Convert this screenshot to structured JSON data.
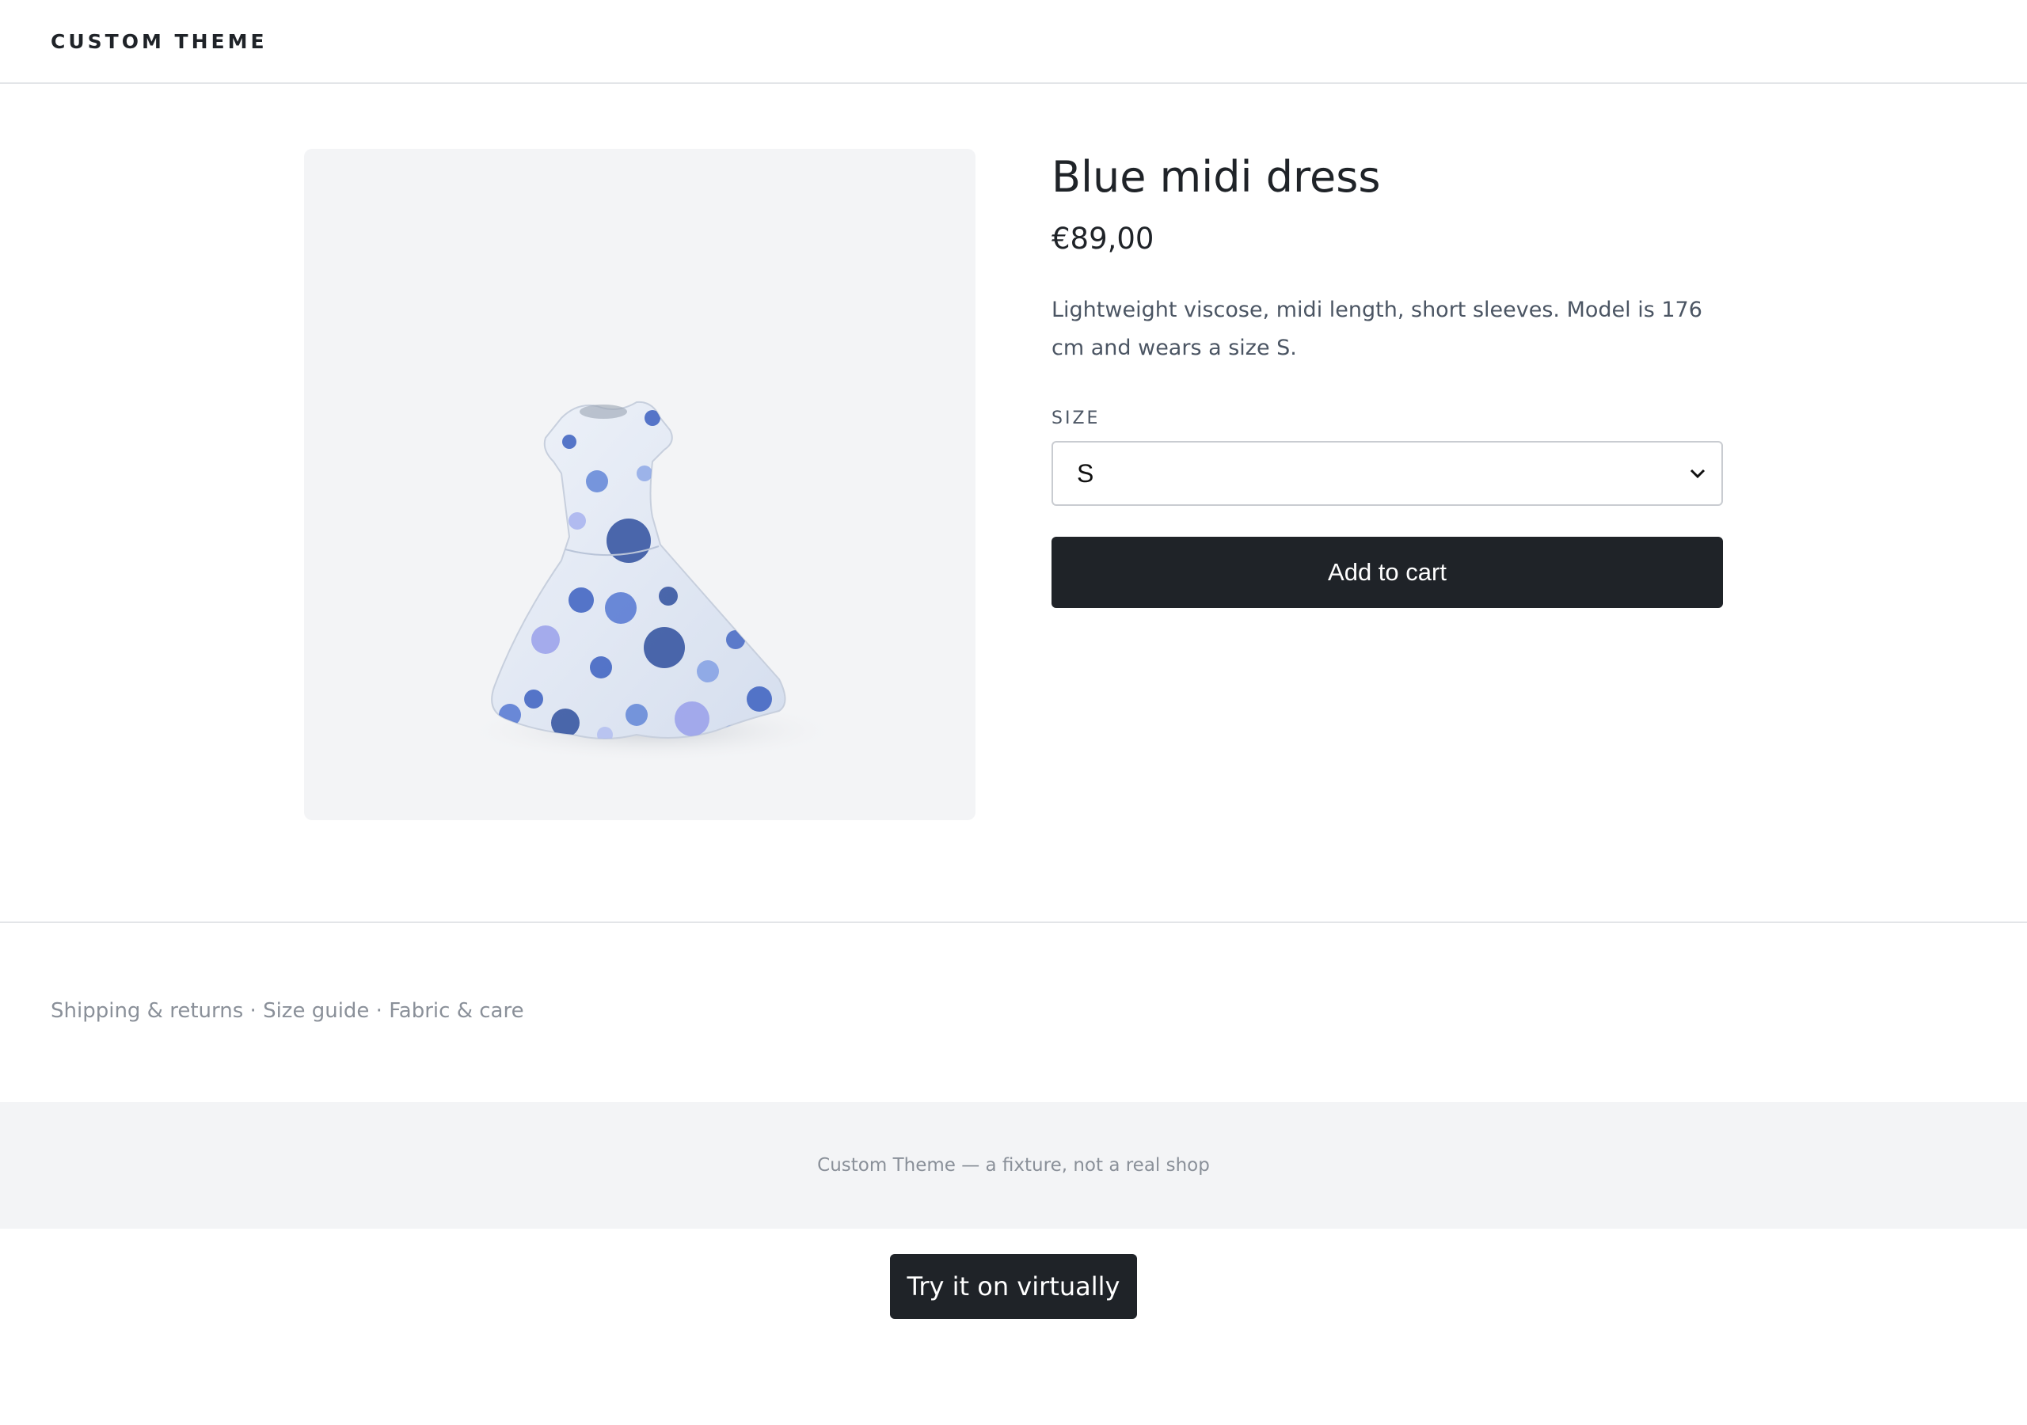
{
  "header": {
    "brand": "CUSTOM THEME"
  },
  "product": {
    "title": "Blue midi dress",
    "price": "€89,00",
    "description": "Lightweight viscose, midi length, short sleeves. Model is 176 cm and wears a size S.",
    "image_alt": "Blue polka-dot midi dress",
    "size": {
      "label": "SIZE",
      "selected": "S"
    },
    "add_to_cart_label": "Add to cart"
  },
  "links": [
    {
      "label": "Shipping & returns"
    },
    {
      "label": "Size guide"
    },
    {
      "label": "Fabric & care"
    }
  ],
  "link_separator": " · ",
  "footer": {
    "text": "Custom Theme — a fixture, not a real shop"
  },
  "virtual_tryon": {
    "label": "Try it on virtually"
  },
  "colors": {
    "dark": "#1f2328",
    "muted": "#8a9099",
    "panel": "#f3f4f6",
    "dress_blue": "#3b5fc0",
    "dress_light": "#e6ecf6"
  }
}
